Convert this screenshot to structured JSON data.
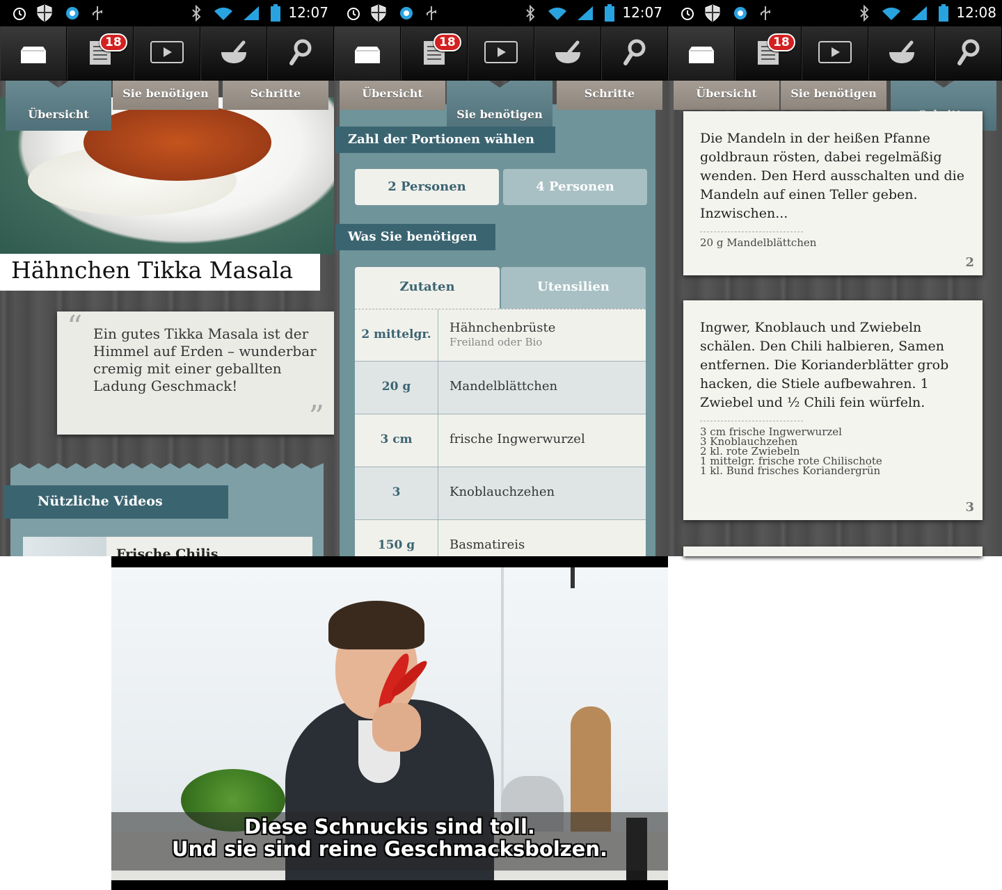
{
  "status_bar": {
    "clocks": [
      "12:07",
      "12:07",
      "12:08"
    ]
  },
  "toolbar": {
    "badge_count": "18",
    "items": [
      {
        "icon": "box-icon"
      },
      {
        "icon": "recipe-list-icon"
      },
      {
        "icon": "video-icon"
      },
      {
        "icon": "mortar-pestle-icon"
      },
      {
        "icon": "search-icon"
      }
    ]
  },
  "tabs": {
    "overview": "Übersicht",
    "ingredients": "Sie benötigen",
    "steps": "Schritte"
  },
  "overview": {
    "title": "Hähnchen Tikka Masala",
    "quote": "Ein gutes Tikka Masala ist der Himmel auf Erden – wunderbar cremig mit einer geballten Ladung Geschmack!",
    "quote_open": "“",
    "quote_close": "”",
    "videos_label": "Nützliche Videos",
    "video_title": "Frische Chilis"
  },
  "needs": {
    "portions_label": "Zahl der Portionen wählen",
    "portion_2": "2 Personen",
    "portion_4": "4 Personen",
    "what_label": "Was Sie benötigen",
    "tab_ingredients": "Zutaten",
    "tab_utensils": "Utensilien",
    "rows": [
      {
        "amount": "2 mittelgr.",
        "name": "Hähnchenbrüste",
        "sub": "Freiland oder Bio"
      },
      {
        "amount": "20 g",
        "name": "Mandelblättchen",
        "sub": ""
      },
      {
        "amount": "3  cm",
        "name": "frische Ingwerwurzel",
        "sub": ""
      },
      {
        "amount": "3",
        "name": "Knoblauchzehen",
        "sub": ""
      },
      {
        "amount": "150 g",
        "name": "Basmatireis",
        "sub": ""
      }
    ]
  },
  "steps": {
    "cards": [
      {
        "text": "Die Mandeln in der heißen Pfanne goldbraun rösten, dabei regelmäßig wenden. Den Herd ausschalten und die Mandeln auf einen Teller geben. Inzwischen...",
        "ingredients": [
          "20 g Mandelblättchen"
        ],
        "number": "2"
      },
      {
        "text": "Ingwer, Knoblauch und Zwiebeln schälen. Den Chili halbieren, Samen entfernen. Die Korianderblätter grob hacken, die Stiele aufbewahren. 1 Zwiebel und ½ Chili fein würfeln.",
        "ingredients": [
          "3  cm frische Ingwerwurzel",
          "3 Knoblauchzehen",
          "2 kl. rote Zwiebeln",
          "1 mittelgr. frische rote Chilischote",
          "1 kl. Bund frisches Koriandergrün"
        ],
        "number": "3"
      }
    ]
  },
  "video": {
    "subtitle_line1": "Diese Schnuckis sind toll.",
    "subtitle_line2": "Und sie sind reine Geschmacksbolzen."
  }
}
